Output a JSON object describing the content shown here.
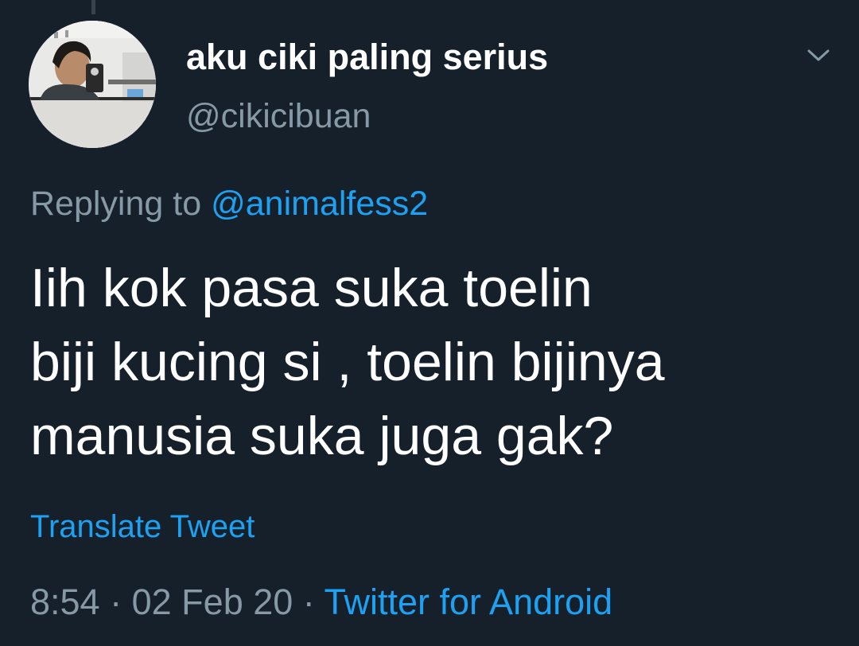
{
  "tweet": {
    "author": {
      "display_name": "aku ciki paling serius",
      "handle": "@cikicibuan"
    },
    "more_icon": "chevron-down-icon",
    "reply": {
      "prefix": "Replying to",
      "mention": "@animalfess2"
    },
    "text_lines": [
      "Iih kok pasa suka toelin",
      "biji kucing si , toelin bijinya",
      "manusia suka juga gak?"
    ],
    "translate_label": "Translate Tweet",
    "meta": {
      "time": "8:54",
      "date": "02 Feb 20",
      "separator": "·",
      "source": "Twitter for Android"
    }
  },
  "colors": {
    "background": "#15202b",
    "primary_text": "#ffffff",
    "secondary_text": "#8899a6",
    "accent": "#1da1f2"
  }
}
